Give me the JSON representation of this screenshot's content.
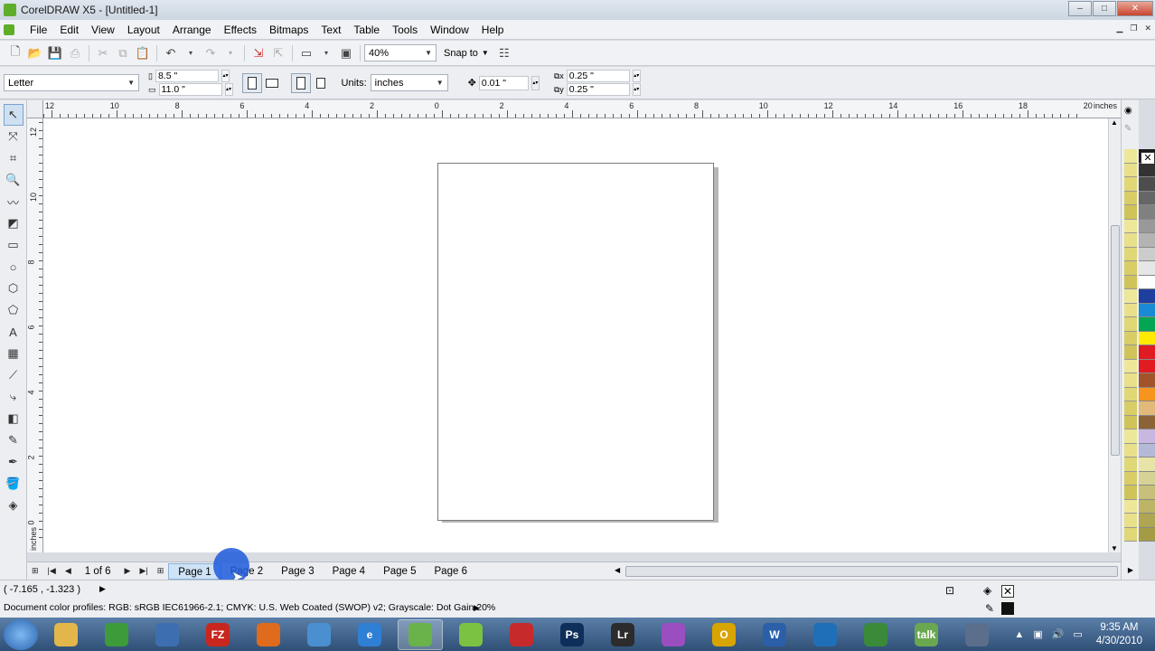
{
  "window": {
    "title": "CorelDRAW X5 - [Untitled-1]",
    "min": "–",
    "max": "□",
    "close": "✕"
  },
  "menu": [
    "File",
    "Edit",
    "View",
    "Layout",
    "Arrange",
    "Effects",
    "Bitmaps",
    "Text",
    "Table",
    "Tools",
    "Window",
    "Help"
  ],
  "toolbar": {
    "zoom": "40%",
    "snap_label": "Snap to"
  },
  "property_bar": {
    "paper": "Letter",
    "width": "8.5 \"",
    "height": "11.0 \"",
    "units_label": "Units:",
    "units": "inches",
    "nudge": "0.01 \"",
    "dup_x": "0.25 \"",
    "dup_y": "0.25 \""
  },
  "ruler": {
    "h_labels": [
      "12",
      "10",
      "8",
      "6",
      "4",
      "2",
      "0",
      "2",
      "4",
      "6",
      "8",
      "10",
      "12",
      "14",
      "16",
      "18",
      "20"
    ],
    "h_unit": "inches",
    "v_labels": [
      "12",
      "10",
      "8",
      "6",
      "4",
      "2",
      "0"
    ],
    "v_unit": "inches"
  },
  "page_nav": {
    "count": "1 of 6",
    "pages": [
      "Page 1",
      "Page 2",
      "Page 3",
      "Page 4",
      "Page 5",
      "Page 6"
    ],
    "active": 0
  },
  "status": {
    "coords": "( -7.165 , -1.323 )",
    "profiles": "Document color profiles: RGB: sRGB IEC61966-2.1; CMYK: U.S. Web Coated (SWOP) v2; Grayscale: Dot Gain 20%"
  },
  "palette_colors": [
    "#1a1a1a",
    "#333333",
    "#4d4d4d",
    "#666666",
    "#808080",
    "#999999",
    "#b3b3b3",
    "#cccccc",
    "#e6e6e6",
    "#ffffff",
    "#1f3f9f",
    "#1a8ad4",
    "#00a651",
    "#ffea00",
    "#e11b22",
    "#e11b22",
    "#a3532a",
    "#f7941d",
    "#e2b97a",
    "#8c6239",
    "#c8b7e0",
    "#b5b9d8",
    "#e8e4a8",
    "#d6d195",
    "#c8c07a",
    "#bdb466",
    "#b0a552",
    "#a59b44"
  ],
  "palette2_colors": [
    "#ede79a",
    "#e8e08a",
    "#e0d776",
    "#d8cd66",
    "#cfc35a",
    "#ede79a",
    "#e8e08a",
    "#e0d776",
    "#d8cd66",
    "#cfc35a",
    "#ede79a",
    "#e8e08a",
    "#e0d776",
    "#d8cd66",
    "#cfc35a",
    "#ede79a",
    "#e8e08a",
    "#e0d776",
    "#d8cd66",
    "#cfc35a",
    "#ede79a",
    "#e8e08a",
    "#e0d776",
    "#d8cd66",
    "#cfc35a",
    "#ede79a",
    "#e8e08a",
    "#e0d776"
  ],
  "taskbar": {
    "apps": [
      {
        "name": "explorer",
        "label": "",
        "color": "#e2b64a"
      },
      {
        "name": "chrome",
        "label": "",
        "color": "#3e9b3a"
      },
      {
        "name": "thunderbird",
        "label": "",
        "color": "#3d6fb0"
      },
      {
        "name": "filezilla",
        "label": "FZ",
        "color": "#c9261e"
      },
      {
        "name": "firefox",
        "label": "",
        "color": "#e06b1d"
      },
      {
        "name": "safari",
        "label": "",
        "color": "#4a8fd0"
      },
      {
        "name": "ie",
        "label": "e",
        "color": "#2f7fd4"
      },
      {
        "name": "corel-active",
        "label": "",
        "color": "#6ab24a"
      },
      {
        "name": "corel",
        "label": "",
        "color": "#7cc242"
      },
      {
        "name": "capture",
        "label": "",
        "color": "#c62a2a"
      },
      {
        "name": "photoshop",
        "label": "Ps",
        "color": "#0e2f5a"
      },
      {
        "name": "lightroom",
        "label": "Lr",
        "color": "#2c2c2c"
      },
      {
        "name": "picasa",
        "label": "",
        "color": "#9a4ec0"
      },
      {
        "name": "app-o",
        "label": "O",
        "color": "#d8a400"
      },
      {
        "name": "word",
        "label": "W",
        "color": "#2b5fa8"
      },
      {
        "name": "teamviewer",
        "label": "",
        "color": "#1f6fb8"
      },
      {
        "name": "people",
        "label": "",
        "color": "#3a8a3a"
      },
      {
        "name": "gtalk",
        "label": "talk",
        "color": "#6aa84f"
      },
      {
        "name": "tools",
        "label": "",
        "color": "#5b6e8c"
      }
    ],
    "time": "9:35 AM",
    "date": "4/30/2010"
  }
}
